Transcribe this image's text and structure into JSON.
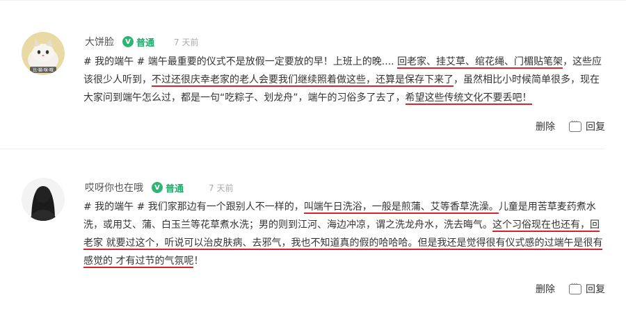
{
  "comments": [
    {
      "username": "大饼脸",
      "badge": "普通",
      "time": "7 天前",
      "segments": [
        {
          "t": "# 我的端午 # 端午最重要的仪式不是放假一定要放的早！上班上的晚.... ",
          "u": false
        },
        {
          "t": "回老家、挂艾草、绾花绳、门楣贴笔架",
          "u": true
        },
        {
          "t": "，这些应该很少人听到，",
          "u": false
        },
        {
          "t": "不过还很庆幸老家的老人会要我们继续照着做这些，还算是保存下来了",
          "u": true
        },
        {
          "t": "，虽然相比小时候简单很多，现在大家问到端午怎么过，都是一句“吃粽子、划龙舟”，端午的习俗多了去了，",
          "u": false
        },
        {
          "t": "希望这些传统文化不要丢吧！",
          "u": true
        }
      ],
      "delete_label": "删除",
      "reply_label": "回复",
      "avatar_caption": "比·猫·咪·哦"
    },
    {
      "username": "哎呀你也在哦",
      "badge": "普通",
      "time": "7 天前",
      "segments": [
        {
          "t": "# 我的端午 # 我们家那边有一个跟别人不一样的，",
          "u": false
        },
        {
          "t": "叫端午日洗浴，一般是煎蒲、艾等香草洗澡。",
          "u": true
        },
        {
          "t": "儿童是用苦草麦药煮水洗，或用艾、蒲、白玉兰等花草煮水洗；男的则到江河、海边冲凉，谓之洗龙舟水，洗去晦气。",
          "u": false
        },
        {
          "t": "这个习俗现在也还有，回老家 就要过这个，听说可以治皮肤病、去邪气，我也不知道真的假的哈哈哈。但是我还是觉得很有仪式感的过端午是很有感觉的 才有过节的气氛呢",
          "u": true
        },
        {
          "t": "！",
          "u": false
        }
      ],
      "delete_label": "删除",
      "reply_label": "回复"
    }
  ],
  "colors": {
    "underline": "#d6222b",
    "badge_green": "#2bb673",
    "muted": "#aaaaaa"
  }
}
